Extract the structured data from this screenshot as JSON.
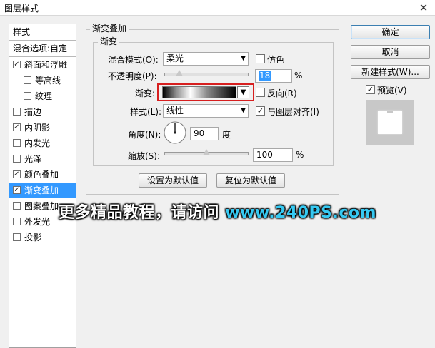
{
  "window": {
    "title": "图层样式",
    "close_glyph": "✕"
  },
  "sidebar": {
    "header_styles": "样式",
    "header_blending": "混合选项:自定",
    "items": [
      {
        "label": "斜面和浮雕",
        "checked": true
      },
      {
        "label": "等高线",
        "checked": false
      },
      {
        "label": "纹理",
        "checked": false
      },
      {
        "label": "描边",
        "checked": false
      },
      {
        "label": "内阴影",
        "checked": true
      },
      {
        "label": "内发光",
        "checked": false
      },
      {
        "label": "光泽",
        "checked": false
      },
      {
        "label": "颜色叠加",
        "checked": true
      },
      {
        "label": "渐变叠加",
        "checked": true,
        "selected": true
      },
      {
        "label": "图案叠加",
        "checked": false
      },
      {
        "label": "外发光",
        "checked": false
      },
      {
        "label": "投影",
        "checked": false
      }
    ]
  },
  "panel": {
    "group_title": "渐变叠加",
    "subgroup_title": "渐变",
    "blend_mode_label": "混合模式(O):",
    "blend_mode_value": "柔光",
    "dither_label": "仿色",
    "dither_checked": false,
    "opacity_label": "不透明度(P):",
    "opacity_value": "18",
    "opacity_unit": "%",
    "gradient_label": "渐变:",
    "reverse_label": "反向(R)",
    "reverse_checked": false,
    "style_label": "样式(L):",
    "style_value": "线性",
    "align_label": "与图层对齐(I)",
    "align_checked": true,
    "angle_label": "角度(N):",
    "angle_value": "90",
    "angle_unit": "度",
    "scale_label": "缩放(S):",
    "scale_value": "100",
    "scale_unit": "%",
    "make_default_label": "设置为默认值",
    "reset_default_label": "复位为默认值"
  },
  "sliders": {
    "opacity_fraction": 0.18,
    "scale_fraction": 0.5
  },
  "right": {
    "ok_label": "确定",
    "cancel_label": "取消",
    "new_style_label": "新建样式(W)...",
    "preview_label": "预览(V)",
    "preview_checked": true
  },
  "watermark": {
    "text": "更多精品教程，请访问",
    "url": "www.240PS.com"
  },
  "colors": {
    "selection": "#3399ff",
    "highlight_border": "#d71f1f",
    "watermark_url": "#36c9f2"
  }
}
